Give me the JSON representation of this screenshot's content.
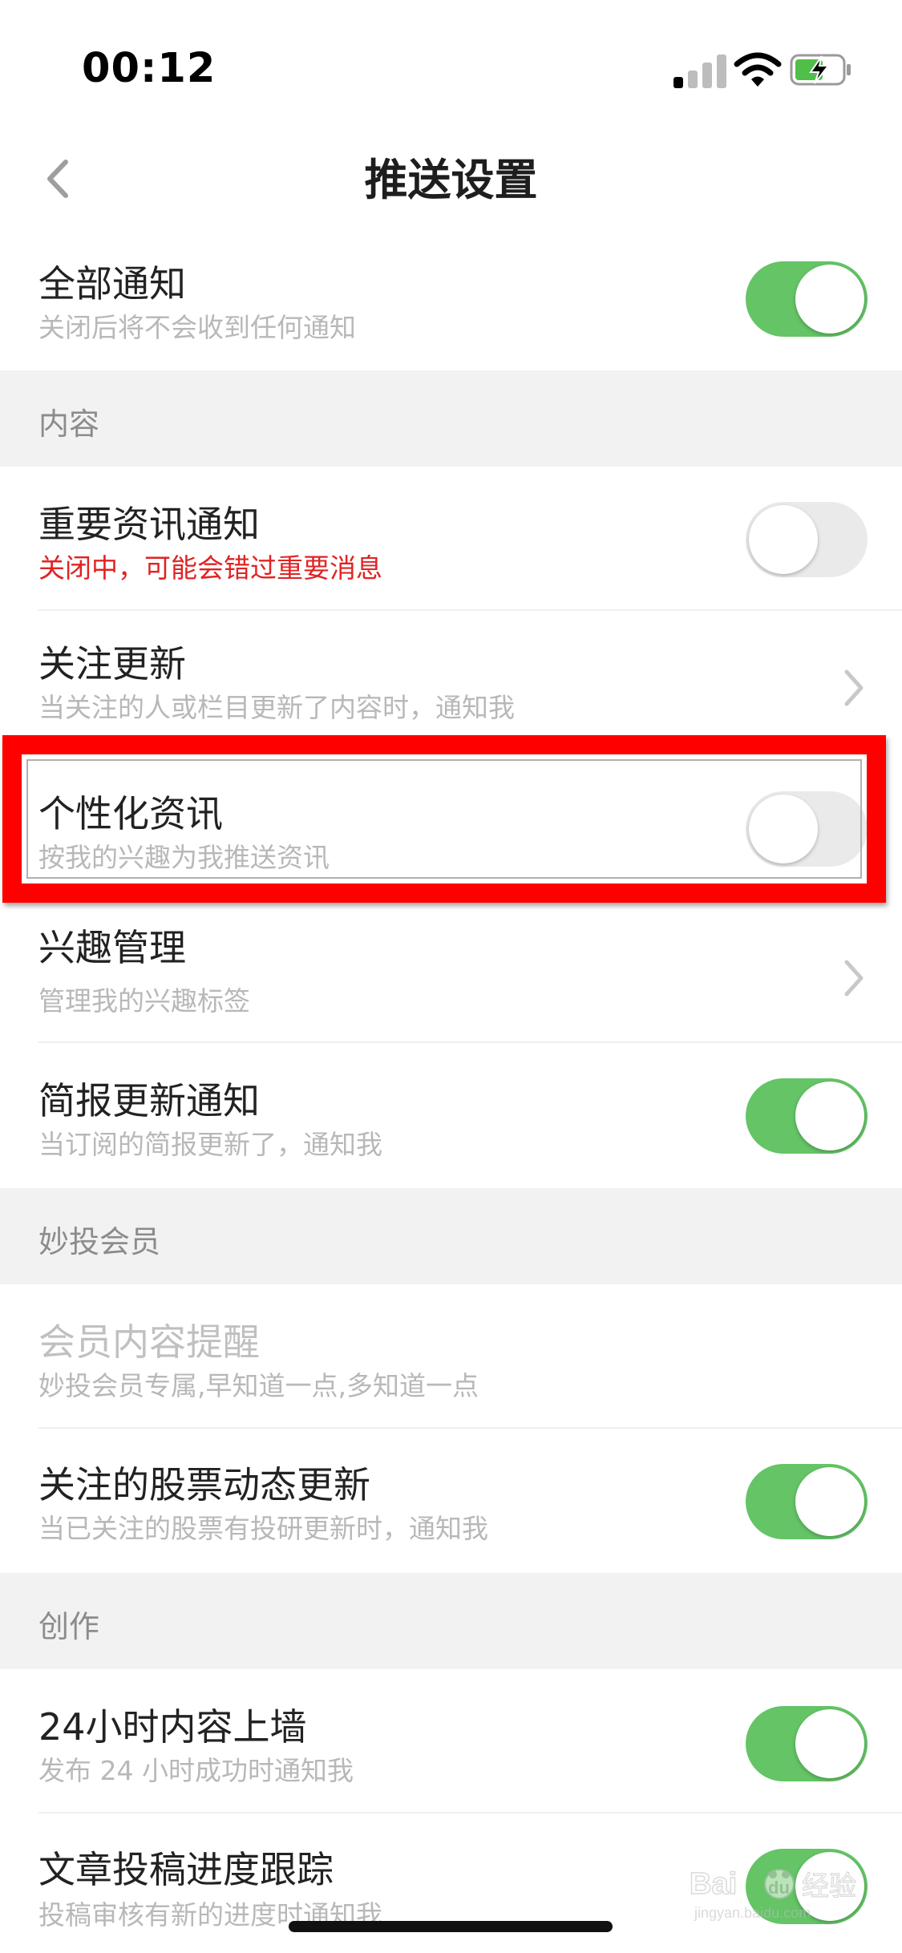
{
  "status_bar": {
    "time": "00:12"
  },
  "nav": {
    "title": "推送设置"
  },
  "rows": {
    "all_notify": {
      "title": "全部通知",
      "subtitle": "关闭后将不会收到任何通知",
      "on": true
    },
    "important": {
      "title": "重要资讯通知",
      "subtitle": "关闭中，可能会错过重要消息",
      "on": false
    },
    "follow": {
      "title": "关注更新",
      "subtitle": "当关注的人或栏目更新了内容时，通知我"
    },
    "personal": {
      "title": "个性化资讯",
      "subtitle": "按我的兴趣为我推送资讯",
      "on": false
    },
    "interest": {
      "title": "兴趣管理",
      "subtitle": "管理我的兴趣标签"
    },
    "brief": {
      "title": "简报更新通知",
      "subtitle": "当订阅的简报更新了，通知我",
      "on": true
    },
    "member": {
      "title": "会员内容提醒",
      "subtitle": "妙投会员专属,早知道一点,多知道一点"
    },
    "stock": {
      "title": "关注的股票动态更新",
      "subtitle": "当已关注的股票有投研更新时，通知我",
      "on": true
    },
    "wall": {
      "title": "24小时内容上墙",
      "subtitle": "发布 24 小时成功时通知我",
      "on": true
    },
    "track": {
      "title": "文章投稿进度跟踪",
      "subtitle": "投稿审核有新的进度时通知我",
      "on": true
    }
  },
  "sections": {
    "content": "内容",
    "member": "妙投会员",
    "create": "创作"
  },
  "colors": {
    "toggle_on": "#64c466",
    "toggle_off": "#eaeaea",
    "warning_text": "#e02323",
    "highlight": "#ff0000"
  },
  "watermark": {
    "brand": "Bai",
    "suffix": "du",
    "cn": "经验",
    "url": "jingyan.baidu.com"
  }
}
